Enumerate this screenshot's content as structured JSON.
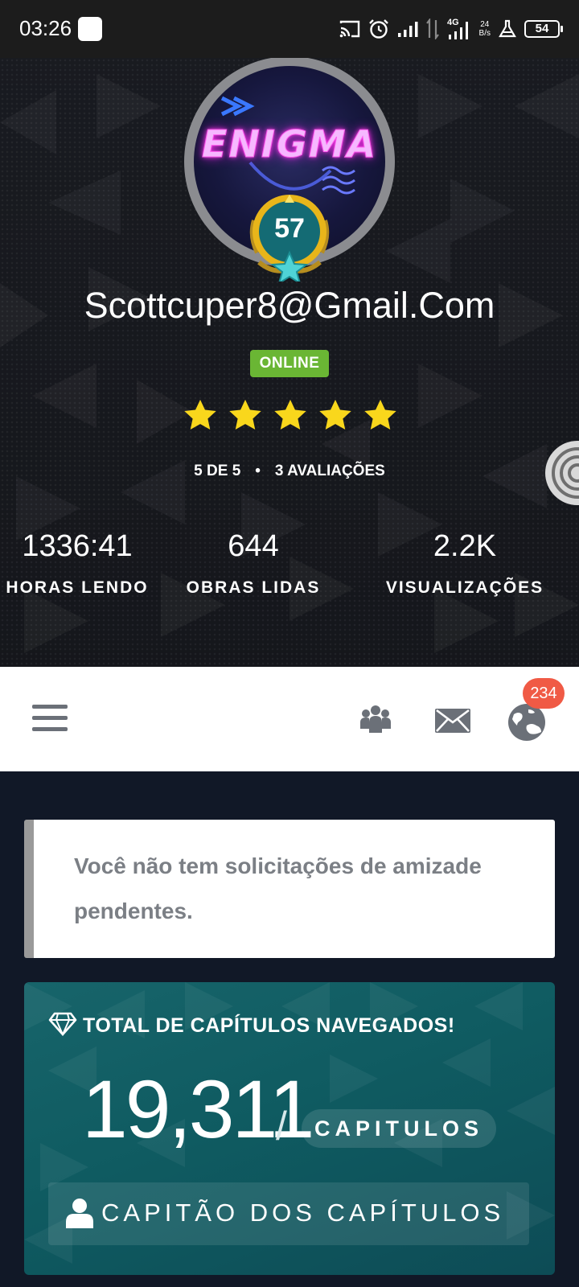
{
  "status_bar": {
    "time": "03:26",
    "net_speed_value": "24",
    "net_speed_unit": "B/s",
    "battery": "54"
  },
  "profile": {
    "avatar_text": "ENIGMA",
    "level": "57",
    "name": "Scottcuper8@Gmail.Com",
    "status": "ONLINE",
    "rating": 5,
    "rating_label": "5 DE 5",
    "rating_separator": "•",
    "reviews_label": "3 AVALIAÇÕES",
    "stats": [
      {
        "value": "1336:41",
        "label": "HORAS LENDO"
      },
      {
        "value": "644",
        "label": "OBRAS LIDAS"
      },
      {
        "value": "2.2K",
        "label": "VISUALIZAÇÕES"
      }
    ]
  },
  "nav": {
    "icons": [
      "menu-icon",
      "friends-icon",
      "mail-icon",
      "globe-icon"
    ],
    "notification_count": "234"
  },
  "friend_requests": {
    "message": "Você não tem solicitações de amizade pendentes."
  },
  "chapters": {
    "title": "TOTAL DE CAPÍTULOS NAVEGADOS!",
    "count": "19,311",
    "slash": "/",
    "unit": "CAPITULOS",
    "rank": "CAPITÃO DOS CAPÍTULOS"
  },
  "colors": {
    "online": "#6ab634",
    "star": "#f9d71c",
    "badge": "#f05a45",
    "card_teal": "#0f5b61",
    "page_bg": "#111827"
  }
}
